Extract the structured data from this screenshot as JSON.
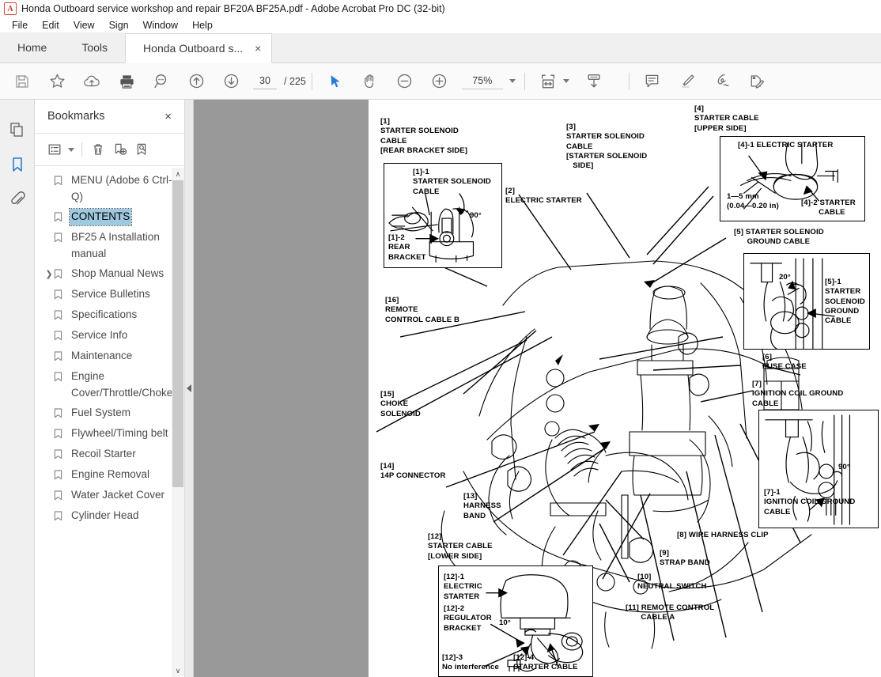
{
  "window": {
    "title": "Honda Outboard service workshop and repair BF20A BF25A.pdf - Adobe Acrobat Pro DC (32-bit)",
    "app_icon": "A"
  },
  "menubar": {
    "items": [
      {
        "label": "File"
      },
      {
        "label": "Edit"
      },
      {
        "label": "View"
      },
      {
        "label": "Sign"
      },
      {
        "label": "Window"
      },
      {
        "label": "Help"
      }
    ]
  },
  "tabs": {
    "home": "Home",
    "tools": "Tools",
    "document": "Honda Outboard s...",
    "close_glyph": "×"
  },
  "toolbar": {
    "icons": [
      "save-icon",
      "star-icon",
      "cloud-upload-icon",
      "print-icon",
      "search-icon",
      "previous-page-icon",
      "next-page-icon"
    ],
    "page_number": "30",
    "page_total": "/ 225",
    "select_tool": "select-cursor-icon",
    "hand_tool": "hand-icon",
    "zoom_out": "zoom-out-icon",
    "zoom_in": "zoom-in-icon",
    "zoom_level": "75%",
    "fit_page": "fit-page-icon",
    "scroll_mode": "scroll-down-icon",
    "comment": "comment-icon",
    "highlight": "highlighter-icon",
    "sign": "sign-pen-icon",
    "fill_sign": "fill-and-sign-icon"
  },
  "rail": {
    "items": [
      {
        "name": "page-thumbnails",
        "icon": "pages-icon",
        "active": false
      },
      {
        "name": "bookmarks",
        "icon": "bookmark-icon",
        "active": true
      },
      {
        "name": "attachments",
        "icon": "paperclip-icon",
        "active": false
      }
    ]
  },
  "bookmarks_panel": {
    "title": "Bookmarks",
    "close_glyph": "×",
    "tools": [
      "bookmark-options-icon",
      "delete-bookmark-icon",
      "new-bookmark-icon",
      "find-bookmark-icon"
    ],
    "items": [
      {
        "label": "MENU (Adobe 6 Ctrl-Q)",
        "expandable": false,
        "selected": false
      },
      {
        "label": "CONTENTS",
        "expandable": false,
        "selected": true
      },
      {
        "label": "BF25 A Installation manual",
        "expandable": false,
        "selected": false
      },
      {
        "label": "Shop Manual News",
        "expandable": true,
        "selected": false
      },
      {
        "label": "Service Bulletins",
        "expandable": false,
        "selected": false
      },
      {
        "label": "Specifications",
        "expandable": false,
        "selected": false
      },
      {
        "label": "Service Info",
        "expandable": false,
        "selected": false
      },
      {
        "label": "Maintenance",
        "expandable": false,
        "selected": false
      },
      {
        "label": "Engine Cover/Throttle/Choke",
        "expandable": false,
        "selected": false
      },
      {
        "label": "Fuel System",
        "expandable": false,
        "selected": false
      },
      {
        "label": "Flywheel/Timing belt",
        "expandable": false,
        "selected": false
      },
      {
        "label": "Recoil Starter",
        "expandable": false,
        "selected": false
      },
      {
        "label": "Engine Removal",
        "expandable": false,
        "selected": false
      },
      {
        "label": "Water Jacket Cover",
        "expandable": false,
        "selected": false
      },
      {
        "label": "Cylinder Head",
        "expandable": false,
        "selected": false
      }
    ],
    "scroll_up_glyph": "∧",
    "scroll_down_glyph": "∨"
  },
  "document_page": {
    "labels": {
      "l1": "[1]\nSTARTER SOLENOID\nCABLE\n[REAR BRACKET SIDE]",
      "l1_1": "[1]-1\nSTARTER SOLENOID\nCABLE",
      "l1_2": "[1]-2\nREAR\nBRACKET",
      "l1_angle": "90°",
      "l2": "[2]\nELECTRIC STARTER",
      "l3": "[3]\nSTARTER SOLENOID\nCABLE\n[STARTER SOLENOID\n   SIDE]",
      "l4": "[4]\nSTARTER CABLE\n[UPPER SIDE]",
      "l4_1": "[4]-1 ELECTRIC STARTER",
      "l4_2": "[4]-2 STARTER\n        CABLE",
      "l4_gap": "1—5 mm\n(0.04—0.20 in)",
      "l5": "[5] STARTER SOLENOID\n      GROUND CABLE",
      "l5_1": "[5]-1\nSTARTER\nSOLENOID\nGROUND\nCABLE",
      "l5_angle": "20°",
      "l6": "[6]\nFUSE CASE",
      "l7": "[7]\nIGNITION COIL GROUND\nCABLE",
      "l7_1": "[7]-1\nIGNITION COIL GROUND\nCABLE",
      "l7_angle": "90°",
      "l8": "[8] WIRE HARNESS CLIP",
      "l9": "[9]\nSTRAP BAND",
      "l10": "[10]\nNEUTRAL SWITCH",
      "l11": "[11] REMOTE CONTROL\n       CABLE A",
      "l12": "[12]\nSTARTER CABLE\n[LOWER SIDE]",
      "l12_1": "[12]-1\nELECTRIC\nSTARTER",
      "l12_2": "[12]-2\nREGULATOR\nBRACKET",
      "l12_3": "[12]-3\nNo interference",
      "l12_4": "[12]-4\nSTARTER CABLE",
      "l12_angle": "10°",
      "l13": "[13]\nHARNESS\nBAND",
      "l14": "[14]\n14P CONNECTOR",
      "l15": "[15]\nCHOKE\nSOLENOID",
      "l16": "[16]\nREMOTE\nCONTROL CABLE B"
    }
  },
  "colors": {
    "accent": "#2b7cd3",
    "selection": "#9ec9e0",
    "viewer_bg": "#999999",
    "chrome_bg": "#f0f0f0"
  }
}
